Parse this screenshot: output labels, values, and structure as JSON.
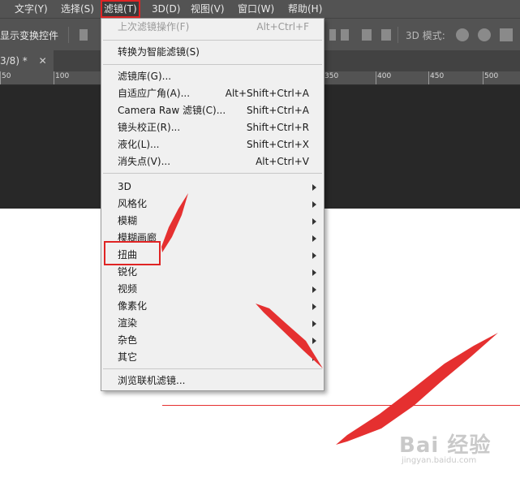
{
  "menubar": {
    "items": [
      {
        "label": "文字(Y)"
      },
      {
        "label": "选择(S)"
      },
      {
        "label": "滤镜(T)"
      },
      {
        "label": "3D(D)"
      },
      {
        "label": "视图(V)"
      },
      {
        "label": "窗口(W)"
      },
      {
        "label": "帮助(H)"
      }
    ]
  },
  "options": {
    "show_transform_label": "显示变换控件",
    "mode_3d_label": "3D 模式:"
  },
  "tab": {
    "label": "3/8) *"
  },
  "ruler": {
    "labels": [
      "50",
      "100",
      "350",
      "400",
      "450",
      "500"
    ]
  },
  "filter_menu": {
    "last_filter": {
      "label": "上次滤镜操作(F)",
      "shortcut": "Alt+Ctrl+F"
    },
    "smart_filter": {
      "label": "转换为智能滤镜(S)"
    },
    "group1": [
      {
        "label": "滤镜库(G)...",
        "shortcut": ""
      },
      {
        "label": "自适应广角(A)...",
        "shortcut": "Alt+Shift+Ctrl+A"
      },
      {
        "label": "Camera Raw 滤镜(C)...",
        "shortcut": "Shift+Ctrl+A"
      },
      {
        "label": "镜头校正(R)...",
        "shortcut": "Shift+Ctrl+R"
      },
      {
        "label": "液化(L)...",
        "shortcut": "Shift+Ctrl+X"
      },
      {
        "label": "消失点(V)...",
        "shortcut": "Alt+Ctrl+V"
      }
    ],
    "submenus": [
      {
        "label": "3D"
      },
      {
        "label": "风格化"
      },
      {
        "label": "模糊"
      },
      {
        "label": "模糊画廊"
      },
      {
        "label": "扭曲"
      },
      {
        "label": "锐化"
      },
      {
        "label": "视频"
      },
      {
        "label": "像素化"
      },
      {
        "label": "渲染"
      },
      {
        "label": "杂色"
      },
      {
        "label": "其它"
      }
    ],
    "browse": {
      "label": "浏览联机滤镜..."
    }
  },
  "watermark": {
    "text": "Bai 经验",
    "sub": "jingyan.baidu.com"
  },
  "colors": {
    "accent": "#e02424",
    "menubar": "#535353",
    "workspace": "#282828",
    "menu_bg": "#f0f0f0"
  }
}
